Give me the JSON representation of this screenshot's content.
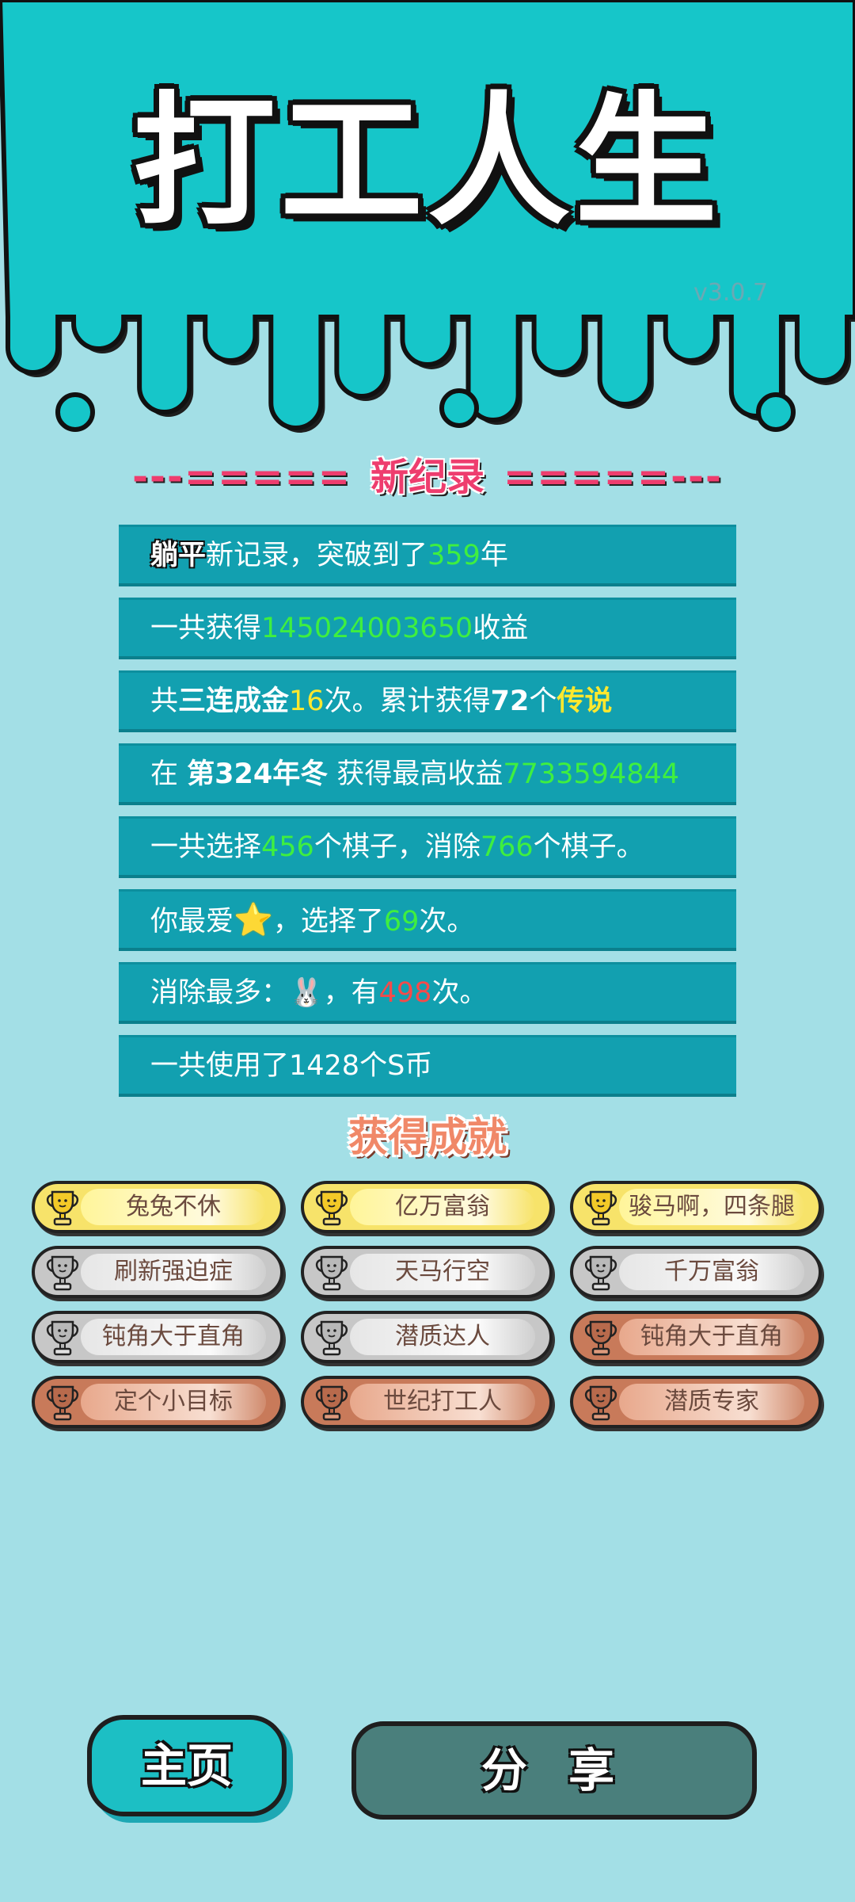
{
  "game": {
    "title": "打工人生",
    "version": "v3.0.7"
  },
  "record": {
    "dashes_left": "---=====",
    "title": "新纪录",
    "dashes_right": "=====---"
  },
  "stats": [
    {
      "parts": [
        {
          "t": "躺平",
          "s": "outline"
        },
        {
          "t": "新记录，突破到了"
        },
        {
          "t": "359",
          "s": "green"
        },
        {
          "t": "年"
        }
      ]
    },
    {
      "parts": [
        {
          "t": "一共获得"
        },
        {
          "t": "145024003650",
          "s": "green"
        },
        {
          "t": "收益"
        }
      ]
    },
    {
      "parts": [
        {
          "t": "共"
        },
        {
          "t": "三连成金",
          "s": "bold"
        },
        {
          "t": "16",
          "s": "yellow"
        },
        {
          "t": "次。累计获得"
        },
        {
          "t": "72",
          "s": "bold"
        },
        {
          "t": "个"
        },
        {
          "t": "传说",
          "s": "yellow-bold"
        }
      ]
    },
    {
      "parts": [
        {
          "t": "在 "
        },
        {
          "t": "第324年冬",
          "s": "bold"
        },
        {
          "t": " 获得最高收益"
        },
        {
          "t": "7733594844",
          "s": "green"
        }
      ]
    },
    {
      "parts": [
        {
          "t": "一共选择"
        },
        {
          "t": "456",
          "s": "green"
        },
        {
          "t": "个棋子，消除"
        },
        {
          "t": "766",
          "s": "green"
        },
        {
          "t": "个棋子。"
        }
      ]
    },
    {
      "parts": [
        {
          "t": "你最爱"
        },
        {
          "t": "⭐",
          "s": "star"
        },
        {
          "t": "，选择了"
        },
        {
          "t": "69",
          "s": "green"
        },
        {
          "t": "次。"
        }
      ]
    },
    {
      "parts": [
        {
          "t": "消除最多："
        },
        {
          "t": "🐰",
          "s": "icon"
        },
        {
          "t": "，有"
        },
        {
          "t": "498",
          "s": "red"
        },
        {
          "t": "次。"
        }
      ]
    },
    {
      "parts": [
        {
          "t": "一共使用了1428个S币"
        }
      ]
    }
  ],
  "achievements_title": "获得成就",
  "achievements": [
    {
      "label": "兔兔不休",
      "tier": "gold"
    },
    {
      "label": "亿万富翁",
      "tier": "gold"
    },
    {
      "label": "骏马啊，四条腿",
      "tier": "gold"
    },
    {
      "label": "刷新强迫症",
      "tier": "silver"
    },
    {
      "label": "天马行空",
      "tier": "silver"
    },
    {
      "label": "千万富翁",
      "tier": "silver"
    },
    {
      "label": "钝角大于直角",
      "tier": "silver"
    },
    {
      "label": "潜质达人",
      "tier": "silver"
    },
    {
      "label": "钝角大于直角",
      "tier": "bronze"
    },
    {
      "label": "定个小目标",
      "tier": "bronze"
    },
    {
      "label": "世纪打工人",
      "tier": "bronze"
    },
    {
      "label": "潜质专家",
      "tier": "bronze"
    }
  ],
  "buttons": {
    "home": "主页",
    "share": "分 享"
  },
  "colors": {
    "top_bg": "#16c6c9",
    "page_bg": "#a3dfe6",
    "row_bg": "#12a0b0",
    "highlight_green": "#3fef3f",
    "highlight_yellow": "#ffe82e",
    "highlight_red": "#f54a4a",
    "record_red": "#ee3d6e"
  }
}
